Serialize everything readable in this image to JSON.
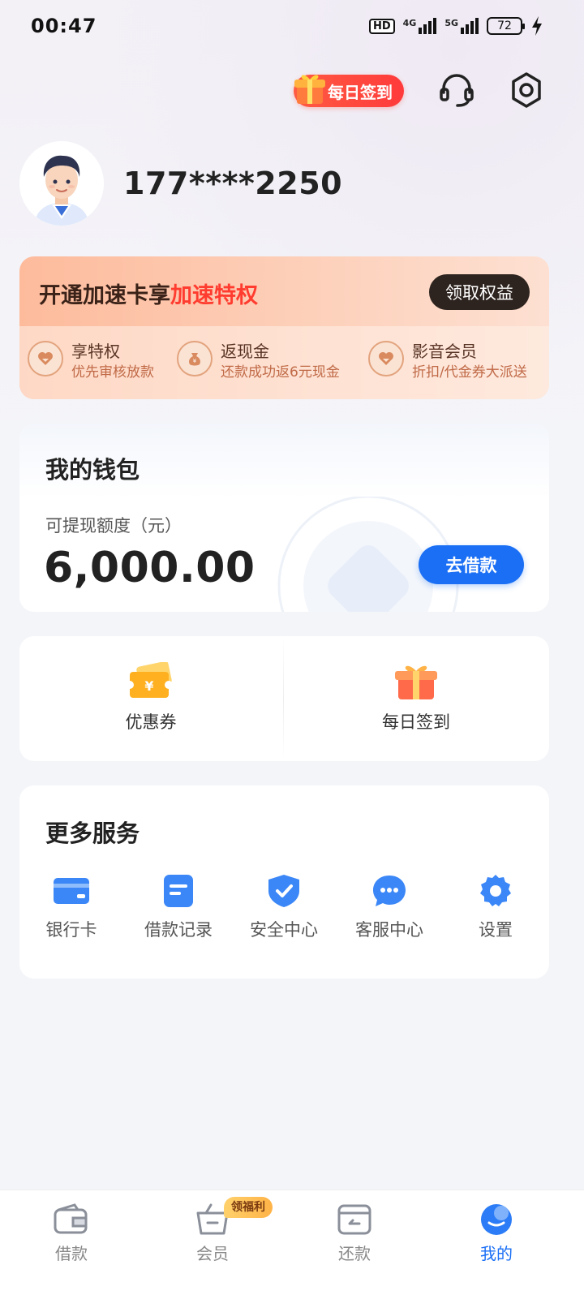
{
  "status_bar": {
    "time": "00:47",
    "hd": "HD",
    "net1": "4G",
    "net2": "5G",
    "battery": "72"
  },
  "header": {
    "checkin_label": "每日签到"
  },
  "profile": {
    "phone": "177****2250"
  },
  "vip": {
    "title_prefix": "开通加速卡享",
    "title_highlight": "加速特权",
    "button": "领取权益",
    "items": [
      {
        "title": "享特权",
        "sub": "优先审核放款",
        "icon": "heart-badge-icon"
      },
      {
        "title": "返现金",
        "sub": "还款成功返6元现金",
        "icon": "money-bag-icon"
      },
      {
        "title": "影音会员",
        "sub": "折扣/代金券大派送",
        "icon": "heart-badge-icon"
      }
    ]
  },
  "wallet": {
    "title": "我的钱包",
    "label": "可提现额度（元）",
    "amount": "6,000.00",
    "button": "去借款"
  },
  "quick": [
    {
      "label": "优惠券",
      "icon": "coupon-icon"
    },
    {
      "label": "每日签到",
      "icon": "gift-icon"
    }
  ],
  "services": {
    "title": "更多服务",
    "items": [
      {
        "label": "银行卡",
        "icon": "bank-card-icon"
      },
      {
        "label": "借款记录",
        "icon": "document-icon"
      },
      {
        "label": "安全中心",
        "icon": "shield-icon"
      },
      {
        "label": "客服中心",
        "icon": "chat-icon"
      },
      {
        "label": "设置",
        "icon": "gear-icon"
      }
    ]
  },
  "tabbar": {
    "items": [
      {
        "label": "借款",
        "icon": "wallet-icon"
      },
      {
        "label": "会员",
        "icon": "basket-icon",
        "badge": "领福利"
      },
      {
        "label": "还款",
        "icon": "repay-icon"
      },
      {
        "label": "我的",
        "icon": "profile-icon",
        "active": true
      }
    ]
  },
  "colors": {
    "accent": "#1a6ff5",
    "highlight": "#ff3c2f",
    "vip_bg": "#fdbb9c"
  }
}
